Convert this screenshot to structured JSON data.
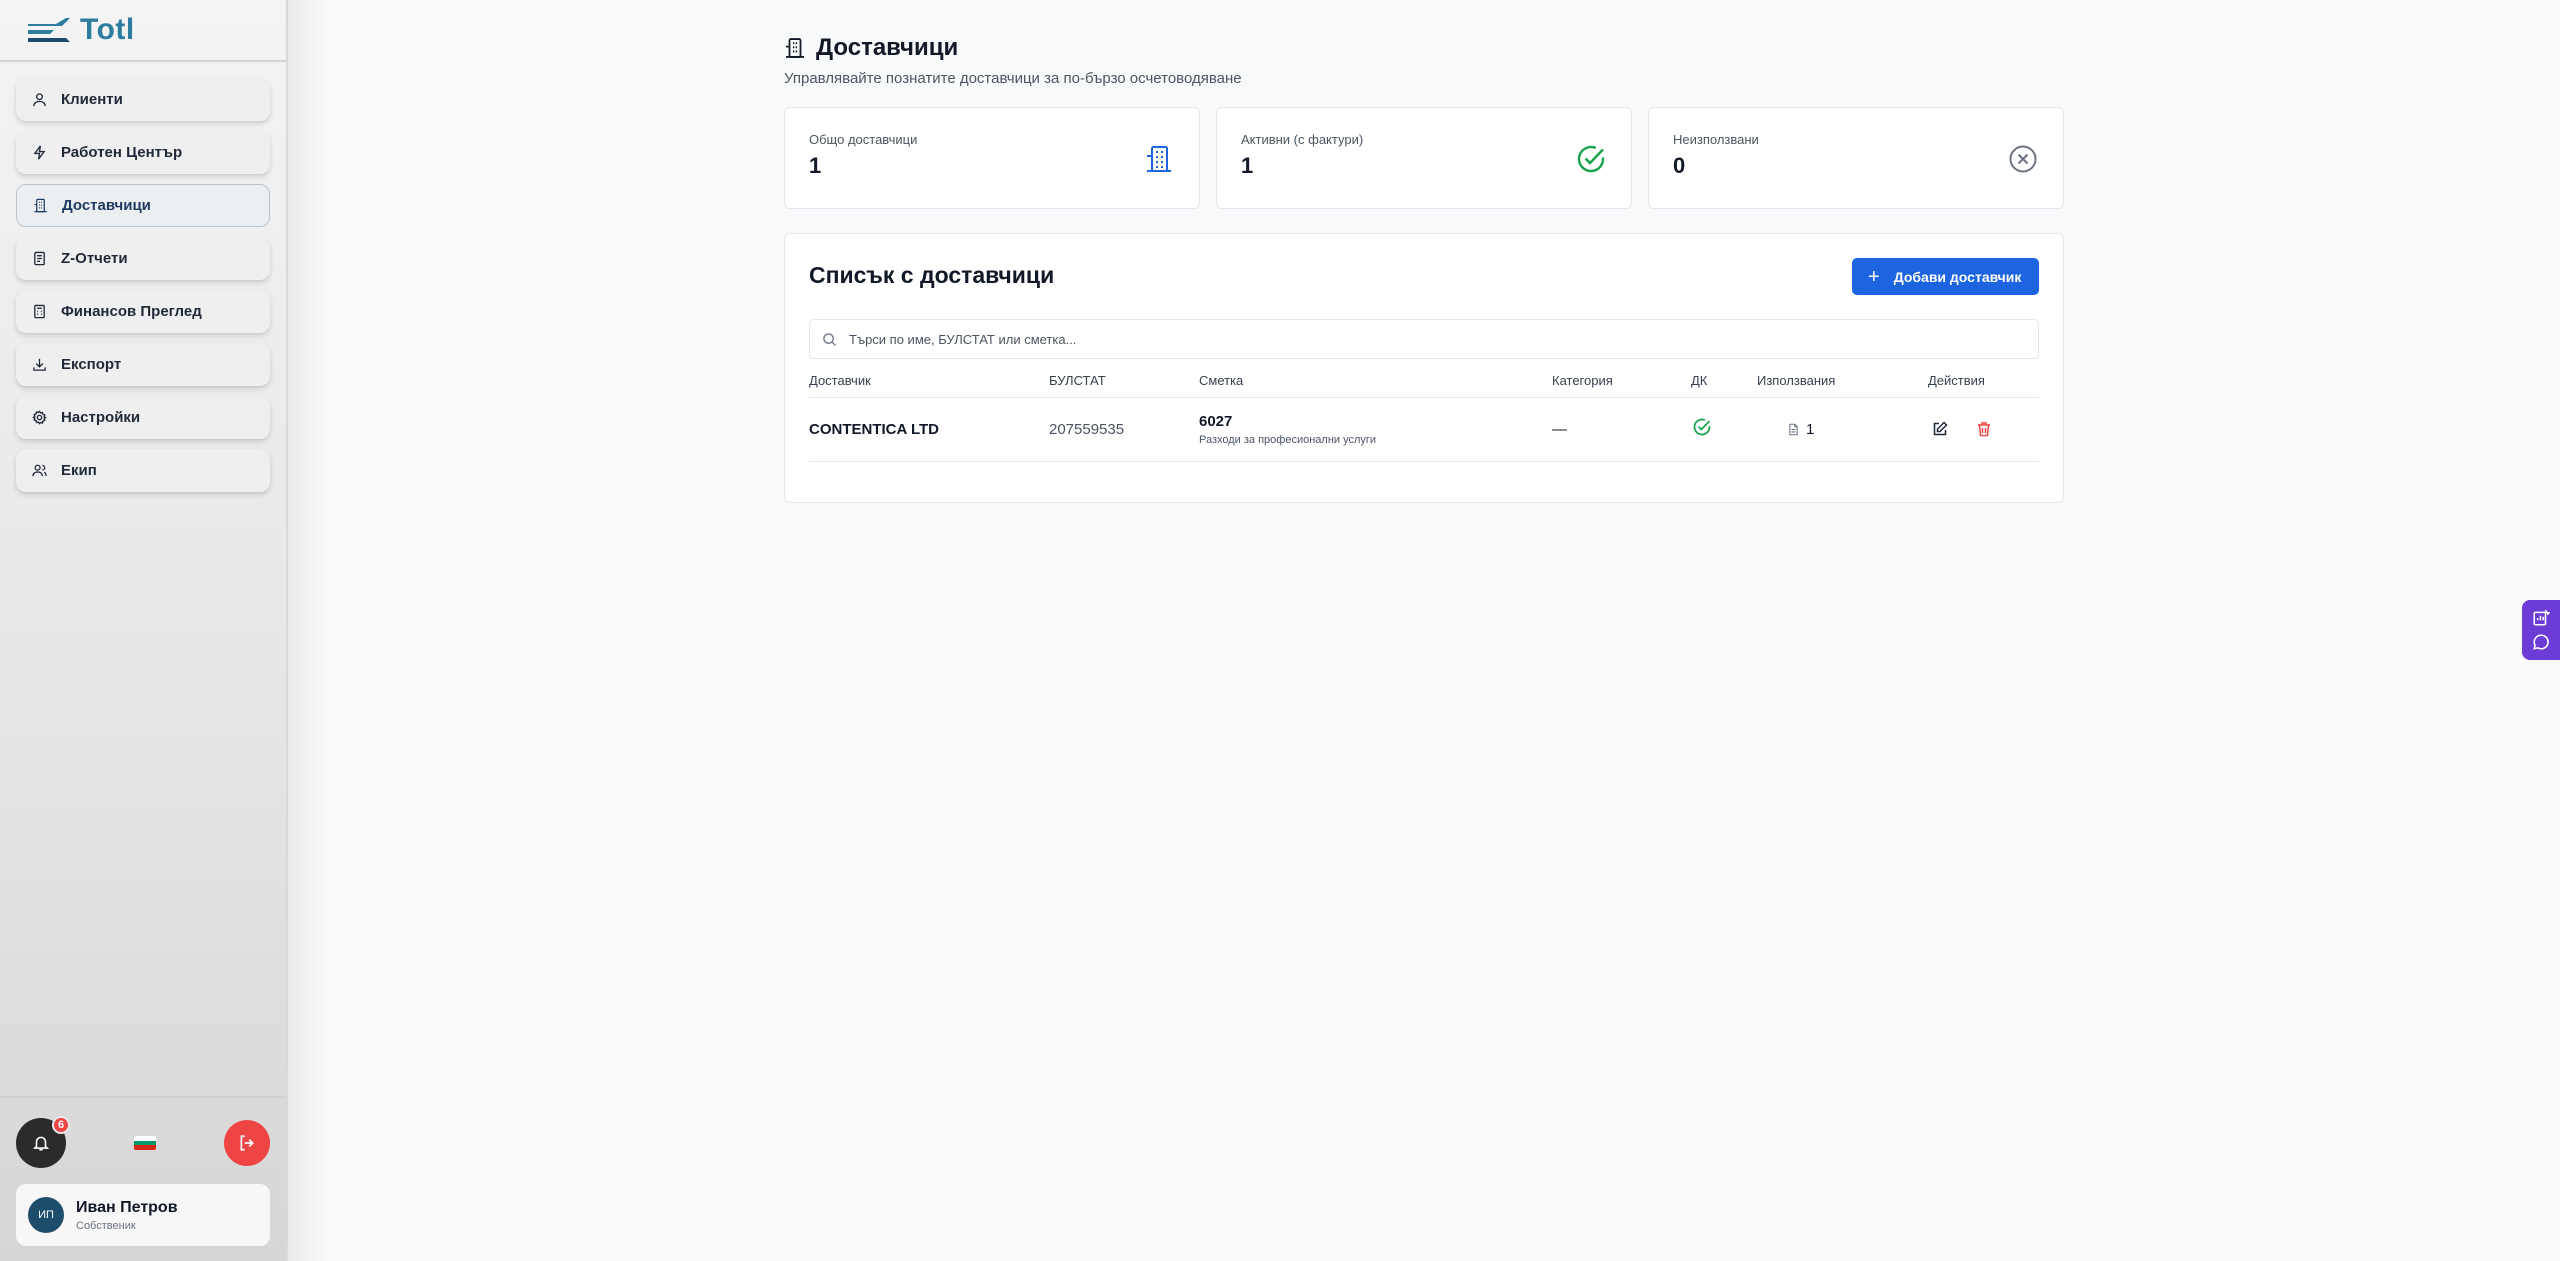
{
  "brand": {
    "name": "Totl"
  },
  "sidebar": {
    "items": [
      {
        "label": "Клиенти",
        "icon": "users-icon"
      },
      {
        "label": "Работен Център",
        "icon": "lightning-icon"
      },
      {
        "label": "Доставчици",
        "icon": "building-icon",
        "active": true
      },
      {
        "label": "Z-Отчети",
        "icon": "receipt-icon"
      },
      {
        "label": "Финансов Преглед",
        "icon": "calculator-icon"
      },
      {
        "label": "Експорт",
        "icon": "download-icon"
      },
      {
        "label": "Настройки",
        "icon": "gear-icon"
      },
      {
        "label": "Екип",
        "icon": "team-icon"
      }
    ],
    "notifications_count": "6",
    "language_flag": "bg",
    "user": {
      "initials": "ИП",
      "name": "Иван Петров",
      "role": "Собственик"
    }
  },
  "page": {
    "title": "Доставчици",
    "subtitle": "Управлявайте познатите доставчици за по-бързо осчетоводяване"
  },
  "stats": [
    {
      "label": "Общо доставчици",
      "value": "1",
      "icon": "building-icon",
      "color": "#1d64e0"
    },
    {
      "label": "Активни (с фактури)",
      "value": "1",
      "icon": "check-circle-icon",
      "color": "#16a34a"
    },
    {
      "label": "Неизползвани",
      "value": "0",
      "icon": "x-circle-icon",
      "color": "#6b7280"
    }
  ],
  "list": {
    "title": "Списък с доставчици",
    "add_button": "Добави доставчик",
    "search_placeholder": "Търси по име, БУЛСТАТ или сметка...",
    "columns": [
      "Доставчик",
      "БУЛСТАТ",
      "Сметка",
      "Категория",
      "ДК",
      "Използвания",
      "Действия"
    ],
    "rows": [
      {
        "name": "CONTENTICA LTD",
        "bulstat": "207559535",
        "account": "6027",
        "account_desc": "Разходи за професионални услуги",
        "category": "—",
        "dk": true,
        "usages": "1"
      }
    ]
  },
  "colors": {
    "primary": "#1d64e0",
    "danger": "#ef4444",
    "success": "#16a34a",
    "widget": "#6d3bd6"
  }
}
